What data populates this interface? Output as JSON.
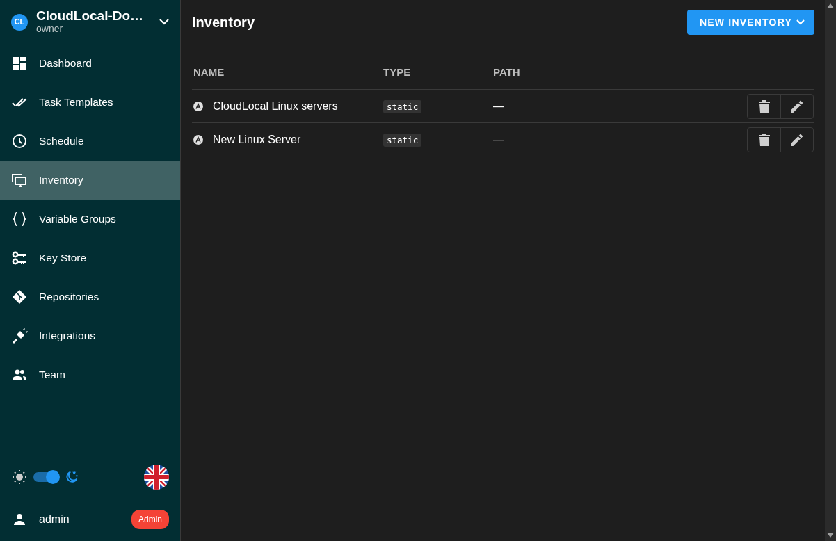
{
  "project": {
    "avatar": "CL",
    "name": "CloudLocal-Do…",
    "role": "owner"
  },
  "nav": [
    {
      "label": "Dashboard",
      "selected": false
    },
    {
      "label": "Task Templates",
      "selected": false
    },
    {
      "label": "Schedule",
      "selected": false
    },
    {
      "label": "Inventory",
      "selected": true
    },
    {
      "label": "Variable Groups",
      "selected": false
    },
    {
      "label": "Key Store",
      "selected": false
    },
    {
      "label": "Repositories",
      "selected": false
    },
    {
      "label": "Integrations",
      "selected": false
    },
    {
      "label": "Team",
      "selected": false
    }
  ],
  "theme": {
    "dark": true
  },
  "user": {
    "name": "admin",
    "badge": "Admin"
  },
  "page": {
    "title": "Inventory",
    "new_button": "NEW INVENTORY"
  },
  "table": {
    "columns": [
      "NAME",
      "TYPE",
      "PATH"
    ],
    "rows": [
      {
        "name": "CloudLocal Linux servers",
        "type": "static",
        "path": "—"
      },
      {
        "name": "New Linux Server",
        "type": "static",
        "path": "—"
      }
    ]
  }
}
